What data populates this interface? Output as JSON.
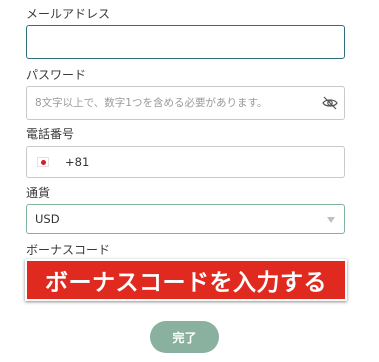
{
  "form": {
    "email": {
      "label": "メールアドレス",
      "value": ""
    },
    "password": {
      "label": "パスワード",
      "placeholder": "8文字以上で、数字1つを含める必要があります。",
      "toggle_icon": "eye-slash-icon"
    },
    "phone": {
      "label": "電話番号",
      "country_flag": "japan-flag-icon",
      "country_code": "+81"
    },
    "currency": {
      "label": "通貨",
      "selected": "USD",
      "dropdown_icon": "chevron-down-icon"
    },
    "bonus_code": {
      "label": "ボーナスコード"
    },
    "submit_label": "完了"
  },
  "annotation": {
    "text": "ボーナスコードを入力する",
    "color": "#e12a1f"
  },
  "colors": {
    "focus_border": "#2f6f7a",
    "select_border": "#7fb39a",
    "submit_button": "#8ab0a0"
  }
}
